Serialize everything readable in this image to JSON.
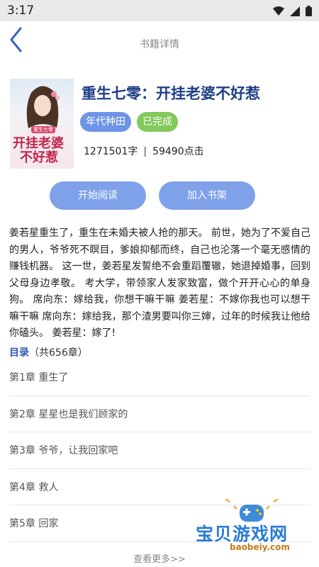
{
  "status_bar": {
    "time": "3:17"
  },
  "nav": {
    "title": "书籍详情"
  },
  "book": {
    "title": "重生七零：开挂老婆不好惹",
    "tags": [
      "年代种田",
      "已完成"
    ],
    "word_count": "1271501字",
    "separator": "|",
    "clicks": "59490点击",
    "cover_title_line1": "开挂老婆",
    "cover_title_line2": "不好惹",
    "cover_badge": "重生七零"
  },
  "actions": {
    "read_label": "开始阅读",
    "shelf_label": "加入书架"
  },
  "description": "姜若星重生了，重生在未婚夫被人抢的那天。 前世，她为了不爱自己的男人，爷爷死不瞑目，爹娘抑郁而终，自己也沦落一个毫无感情的赚钱机器。 这一世，姜若星发誓绝不会重蹈覆辙，她退掉婚事，回到父母身边孝敬。 考大学，带领家人发家致富，做个开开心心的单身狗。 席向东：嫁给我，你想干嘛干嘛 姜若星：不嫁你我也可以想干嘛干嘛 席向东：嫁给我，那个渣男要叫你三婶，过年的时候我让他给你磕头。 姜若星：嫁了!",
  "toc": {
    "label": "目录",
    "count": "（共656章）",
    "chapters": [
      "第1章 重生了",
      "第2章 星星也是我们顾家的",
      "第3章 爷爷，让我回家吧",
      "第4章 救人",
      "第5章 回家"
    ],
    "more_label": "查看更多>>"
  },
  "watermark": {
    "text": "宝贝游戏网",
    "url": "baobeiy.com"
  },
  "colors": {
    "accent": "#7ea1ea",
    "title": "#1f3f86",
    "tag_genre": "#6e94e8",
    "tag_status": "#83c95b"
  }
}
